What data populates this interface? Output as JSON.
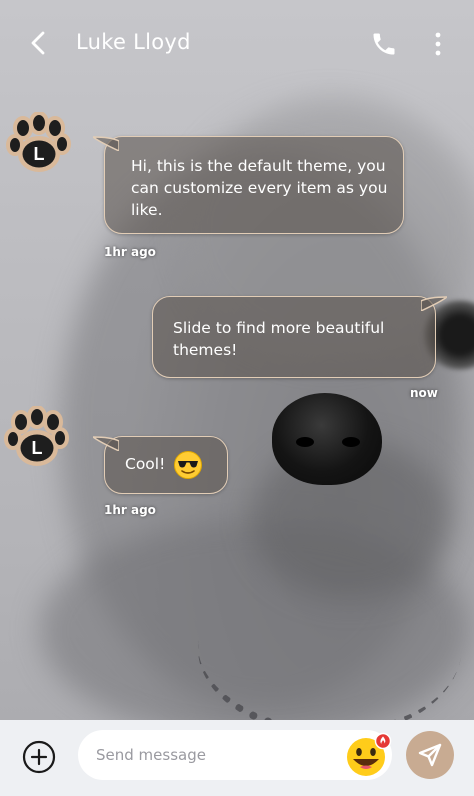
{
  "header": {
    "title": "Luke Lloyd",
    "back_icon": "chevron-left-icon",
    "call_icon": "phone-icon",
    "menu_icon": "more-vertical-icon"
  },
  "contact": {
    "avatar_letter": "L",
    "avatar_icon": "paw-icon"
  },
  "messages": [
    {
      "from": "contact",
      "text": "Hi, this is the default theme, you can customize every item as you like.",
      "time": "1hr ago"
    },
    {
      "from": "me",
      "text": "Slide to find more beautiful themes!",
      "time": "now"
    },
    {
      "from": "contact",
      "text": "Cool!",
      "emoji": "sunglasses-emoji",
      "time": "1hr ago"
    }
  ],
  "composer": {
    "placeholder": "Send message",
    "add_icon": "plus-circle-icon",
    "emoji_icon": "grinning-emoji-icon",
    "send_icon": "send-icon"
  },
  "colors": {
    "bubble_border": "#e2cdb6",
    "bubble_fill": "#5c5450",
    "send_button": "#c8ab92",
    "notification_badge": "#e53935"
  }
}
